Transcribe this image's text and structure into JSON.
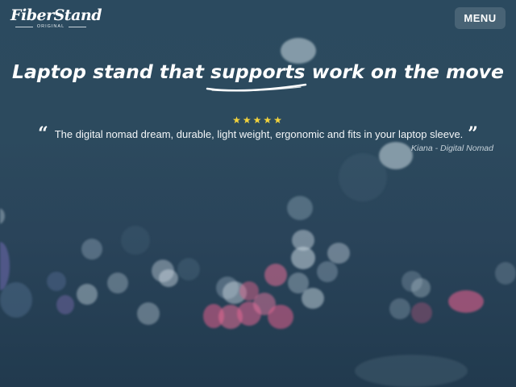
{
  "brand": {
    "name": "FiberStand",
    "tagline": "ORIGINAL"
  },
  "nav": {
    "menu_label": "MENU"
  },
  "hero": {
    "headline_before": "Laptop stand that ",
    "headline_emphasis": "supports",
    "headline_after": " work on the move"
  },
  "testimonial": {
    "stars": "★★★★★",
    "rating": 5,
    "open_quote": "“",
    "quote": "The digital nomad dream, durable, light weight, ergonomic and fits in your laptop sleeve.",
    "close_quote": "”",
    "attribution": "Kiana - Digital Nomad"
  },
  "colors": {
    "star": "#f3d33c",
    "background": "#2c4a5e",
    "text": "#ffffff"
  }
}
